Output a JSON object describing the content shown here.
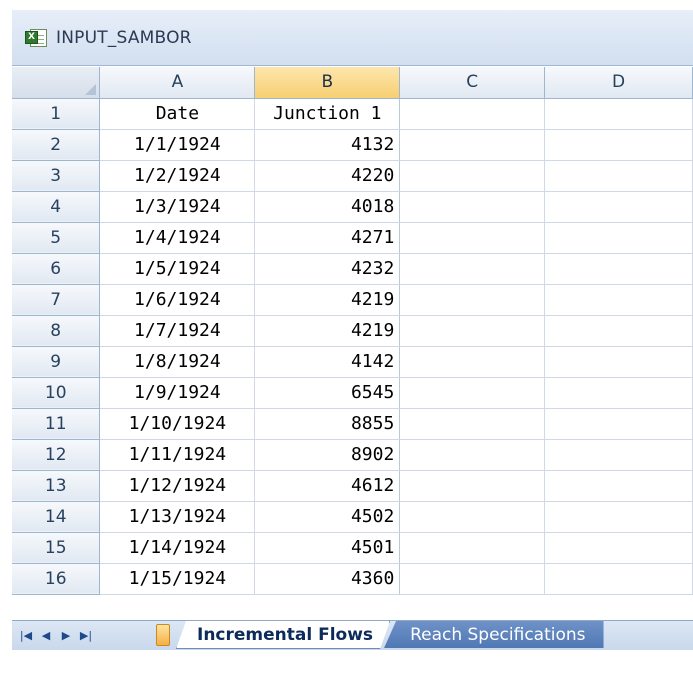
{
  "window": {
    "title": "INPUT_SAMBOR",
    "icon": "excel-workbook-icon"
  },
  "sheet": {
    "columns": [
      "A",
      "B",
      "C",
      "D"
    ],
    "selected_column": "B",
    "header_row": {
      "row": "1",
      "a": "Date",
      "b": "Junction 1"
    },
    "rows": [
      {
        "row": "2",
        "date": "1/1/1924",
        "value": "4132"
      },
      {
        "row": "3",
        "date": "1/2/1924",
        "value": "4220"
      },
      {
        "row": "4",
        "date": "1/3/1924",
        "value": "4018"
      },
      {
        "row": "5",
        "date": "1/4/1924",
        "value": "4271"
      },
      {
        "row": "6",
        "date": "1/5/1924",
        "value": "4232"
      },
      {
        "row": "7",
        "date": "1/6/1924",
        "value": "4219"
      },
      {
        "row": "8",
        "date": "1/7/1924",
        "value": "4219"
      },
      {
        "row": "9",
        "date": "1/8/1924",
        "value": "4142"
      },
      {
        "row": "10",
        "date": "1/9/1924",
        "value": "6545"
      },
      {
        "row": "11",
        "date": "1/10/1924",
        "value": "8855"
      },
      {
        "row": "12",
        "date": "1/11/1924",
        "value": "8902"
      },
      {
        "row": "13",
        "date": "1/12/1924",
        "value": "4612"
      },
      {
        "row": "14",
        "date": "1/13/1924",
        "value": "4502"
      },
      {
        "row": "15",
        "date": "1/14/1924",
        "value": "4501"
      },
      {
        "row": "16",
        "date": "1/15/1924",
        "value": "4360"
      }
    ]
  },
  "tabs": {
    "nav_icons": [
      "first-sheet-icon",
      "prev-sheet-icon",
      "next-sheet-icon",
      "last-sheet-icon"
    ],
    "active": "Incremental Flows",
    "inactive": "Reach Specifications"
  },
  "colors": {
    "selected_header": "#f8cf72",
    "gridline": "#d0d7e5",
    "header_text": "#27415f",
    "tab_inactive": "#4f78b4"
  }
}
